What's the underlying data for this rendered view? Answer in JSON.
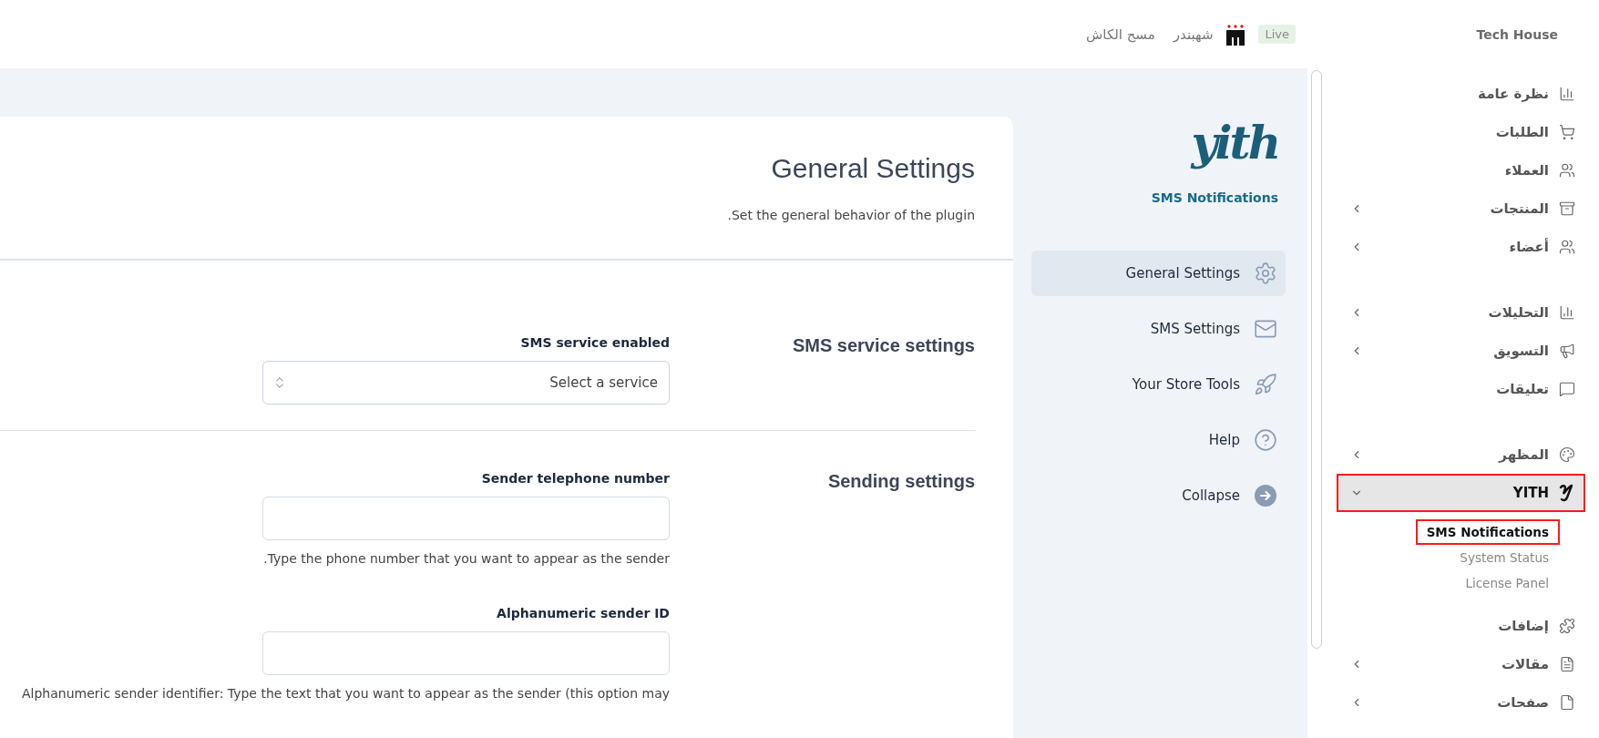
{
  "topbar": {
    "site_name": "Tech House",
    "badge": "Live",
    "brand": "شهبندر",
    "clear_cache": "مسح الكاش"
  },
  "sidebar": {
    "groups": [
      {
        "items": [
          {
            "label": "نظرة عامة",
            "has_submenu": false,
            "highlighted": false
          },
          {
            "label": "الطلبات",
            "has_submenu": false,
            "highlighted": false
          },
          {
            "label": "العملاء",
            "has_submenu": false,
            "highlighted": false
          },
          {
            "label": "المنتجات",
            "has_submenu": true,
            "expanded": false,
            "highlighted": false
          },
          {
            "label": "أعضاء",
            "has_submenu": true,
            "expanded": false,
            "highlighted": false
          }
        ]
      },
      {
        "items": [
          {
            "label": "التحليلات",
            "has_submenu": true,
            "expanded": false,
            "highlighted": false
          },
          {
            "label": "التسويق",
            "has_submenu": true,
            "expanded": false,
            "highlighted": false
          },
          {
            "label": "تعليقات",
            "has_submenu": false,
            "highlighted": false
          }
        ]
      },
      {
        "items": [
          {
            "label": "المظهر",
            "has_submenu": true,
            "expanded": false,
            "highlighted": false
          },
          {
            "label": "YITH",
            "has_submenu": true,
            "expanded": true,
            "highlighted": true,
            "children": [
              {
                "label": "SMS Notifications",
                "selected": true,
                "highlighted": true
              },
              {
                "label": "System Status",
                "selected": false,
                "highlighted": false
              },
              {
                "label": "License Panel",
                "selected": false,
                "highlighted": false
              }
            ]
          },
          {
            "label": "إضافات",
            "has_submenu": false,
            "highlighted": false
          },
          {
            "label": "مقالات",
            "has_submenu": true,
            "expanded": false,
            "highlighted": false
          },
          {
            "label": "صفحات",
            "has_submenu": true,
            "expanded": false,
            "highlighted": false
          }
        ]
      }
    ]
  },
  "plugin_nav": {
    "logo": "yith",
    "product": "SMS Notifications",
    "items": [
      {
        "label": "General Settings",
        "selected": true
      },
      {
        "label": "SMS Settings",
        "selected": false
      },
      {
        "label": "Your Store Tools",
        "selected": false
      },
      {
        "label": "Help",
        "selected": false
      },
      {
        "label": "Collapse",
        "selected": false
      }
    ]
  },
  "content": {
    "title": "General Settings",
    "description": "Set the general behavior of the plugin.",
    "sections": [
      {
        "title": "SMS service settings",
        "fields": [
          {
            "kind": "select",
            "label": "SMS service enabled",
            "placeholder": "Select a service"
          }
        ]
      },
      {
        "title": "Sending settings",
        "fields": [
          {
            "kind": "text",
            "label": "Sender telephone number",
            "description": "Type the phone number that you want to appear as the sender."
          },
          {
            "kind": "text",
            "label": "Alphanumeric sender ID",
            "description": "Alphanumeric sender identifier: Type the text that you want to appear as the sender (this option may"
          }
        ]
      }
    ]
  }
}
